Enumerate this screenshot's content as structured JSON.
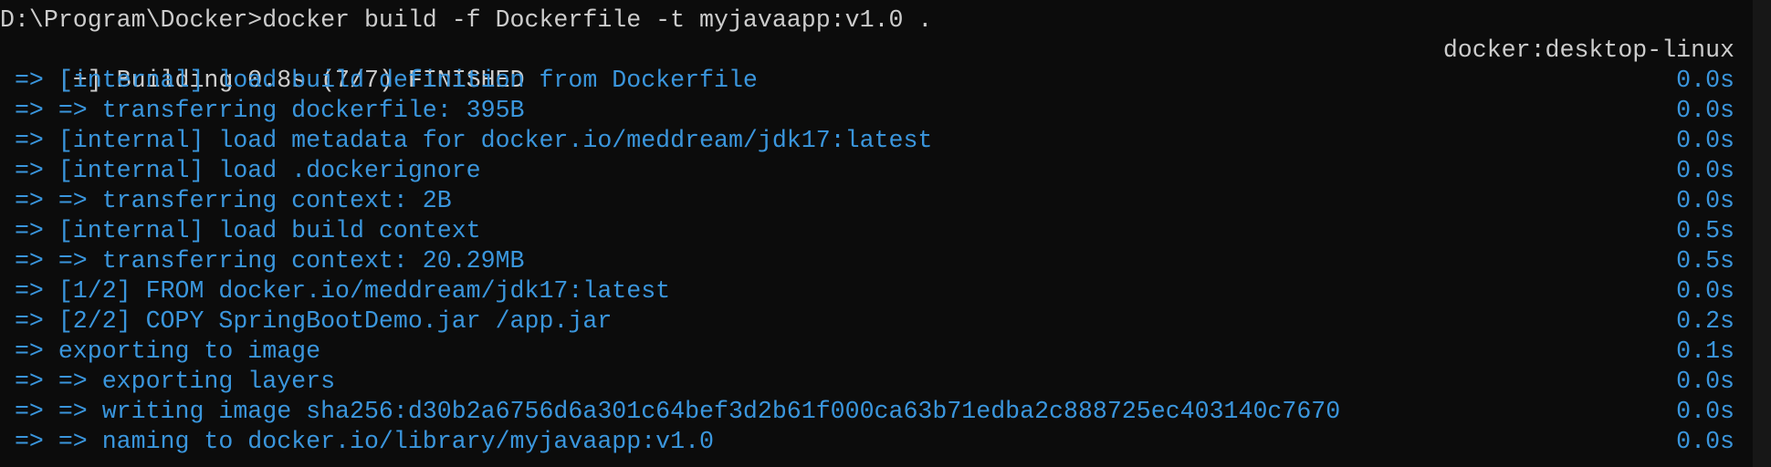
{
  "terminal": {
    "command_line": "D:\\Program\\Docker>docker build -f Dockerfile -t myjavaapp:v1.0 .",
    "header": {
      "left": "[+] Building 0.8s (7/7) FINISHED",
      "right": "docker:desktop-linux"
    },
    "steps": [
      {
        "text": " => [internal] load build definition from Dockerfile",
        "time": "0.0s"
      },
      {
        "text": " => => transferring dockerfile: 395B",
        "time": "0.0s"
      },
      {
        "text": " => [internal] load metadata for docker.io/meddream/jdk17:latest",
        "time": "0.0s"
      },
      {
        "text": " => [internal] load .dockerignore",
        "time": "0.0s"
      },
      {
        "text": " => => transferring context: 2B",
        "time": "0.0s"
      },
      {
        "text": " => [internal] load build context",
        "time": "0.5s"
      },
      {
        "text": " => => transferring context: 20.29MB",
        "time": "0.5s"
      },
      {
        "text": " => [1/2] FROM docker.io/meddream/jdk17:latest",
        "time": "0.0s"
      },
      {
        "text": " => [2/2] COPY SpringBootDemo.jar /app.jar",
        "time": "0.2s"
      },
      {
        "text": " => exporting to image",
        "time": "0.1s"
      },
      {
        "text": " => => exporting layers",
        "time": "0.0s"
      },
      {
        "text": " => => writing image sha256:d30b2a6756d6a301c64bef3d2b61f000ca63b71edba2c888725ec403140c7670",
        "time": "0.0s"
      },
      {
        "text": " => => naming to docker.io/library/myjavaapp:v1.0",
        "time": "0.0s"
      }
    ]
  },
  "colors": {
    "background": "#0c0c0c",
    "text": "#cccccc",
    "step": "#3a96dd"
  }
}
